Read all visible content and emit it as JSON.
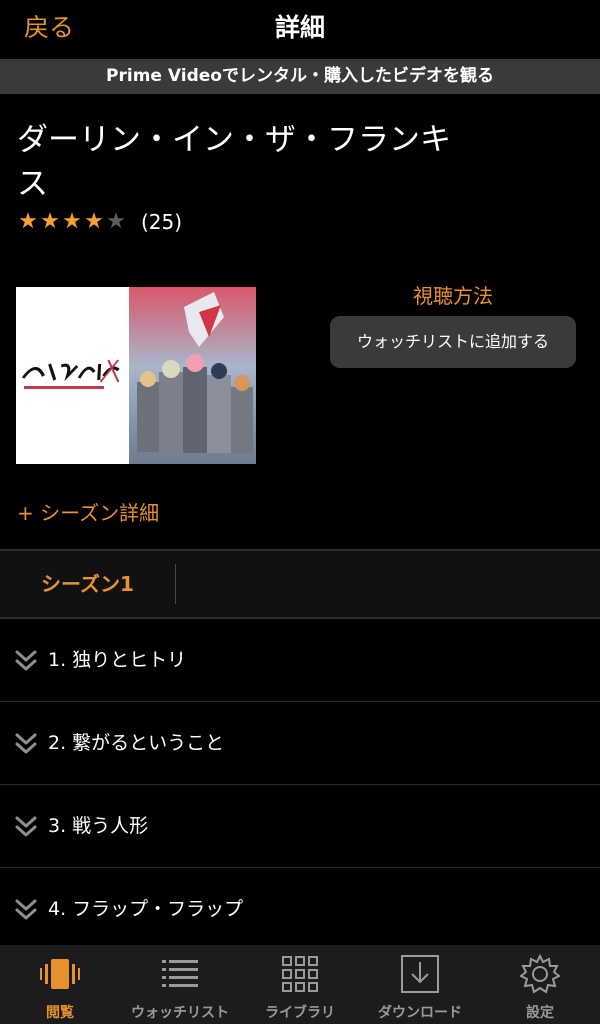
{
  "nav": {
    "back_label": "戻る",
    "title": "詳細"
  },
  "banner": {
    "text": "Prime Videoでレンタル・購入したビデオを観る"
  },
  "show": {
    "title": "ダーリン・イン・ザ・フランキス",
    "rating": {
      "value": 4,
      "max": 5,
      "count_text": "(25)"
    },
    "cover_logo_text": "ダーリン・イン・ザ・フランキス"
  },
  "actions": {
    "watch_method_label": "視聴方法",
    "watchlist_button_label": "ウォッチリストに追加する"
  },
  "season_details_label": "+ シーズン詳細",
  "season_tabs": [
    {
      "label": "シーズン1",
      "selected": true
    }
  ],
  "episodes": [
    {
      "label": "1. 独りとヒトリ"
    },
    {
      "label": "2. 繋がるということ"
    },
    {
      "label": "3. 戦う人形"
    },
    {
      "label": "4. フラップ・フラップ"
    }
  ],
  "tabbar": {
    "items": [
      {
        "label": "閲覧",
        "icon": "browse-icon",
        "active": true
      },
      {
        "label": "ウォッチリスト",
        "icon": "list-icon",
        "active": false
      },
      {
        "label": "ライブラリ",
        "icon": "grid-icon",
        "active": false
      },
      {
        "label": "ダウンロード",
        "icon": "download-icon",
        "active": false
      },
      {
        "label": "設定",
        "icon": "gear-icon",
        "active": false
      }
    ]
  },
  "colors": {
    "accent": "#e8912f",
    "background": "#000000",
    "button_bg": "#3a3a3c",
    "tabbar_bg": "#1c1c1e",
    "star": "#f3a233",
    "star_empty": "#5d5d5d"
  }
}
